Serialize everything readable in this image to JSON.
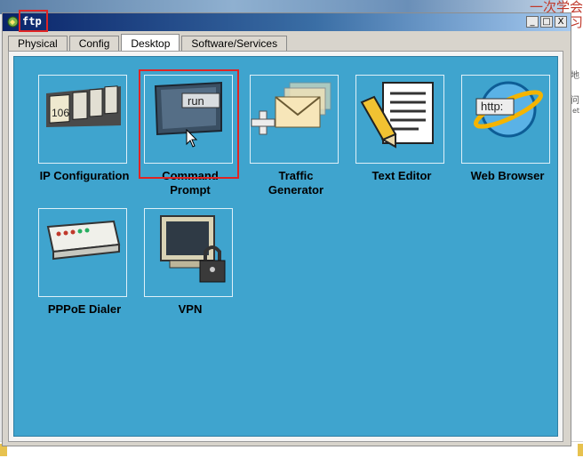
{
  "window": {
    "title": "ftp",
    "controls": {
      "minimize": "_",
      "maximize": "□",
      "close": "X"
    }
  },
  "tabs": [
    {
      "label": "Physical",
      "active": false
    },
    {
      "label": "Config",
      "active": false
    },
    {
      "label": "Desktop",
      "active": true
    },
    {
      "label": "Software/Services",
      "active": false
    }
  ],
  "apps": {
    "ip_config": {
      "label": "IP Configuration",
      "icon": "ip-configuration-icon",
      "icon_text": "106"
    },
    "command_prompt": {
      "label": "Command Prompt",
      "icon": "command-prompt-icon",
      "icon_text": "run",
      "highlighted": true
    },
    "traffic_generator": {
      "label": "Traffic Generator",
      "icon": "traffic-generator-icon"
    },
    "text_editor": {
      "label": "Text Editor",
      "icon": "text-editor-icon"
    },
    "web_browser": {
      "label": "Web Browser",
      "icon": "web-browser-icon",
      "icon_text": "http:"
    },
    "pppoe_dialer": {
      "label": "PPPoE Dialer",
      "icon": "pppoe-dialer-icon"
    },
    "vpn": {
      "label": "VPN",
      "icon": "vpn-icon"
    }
  },
  "background": {
    "chinese_top": "一次学会",
    "chinese_mid": "解百学习",
    "side_char_1": "地",
    "side_char_2": "问",
    "side_char_3": "et"
  },
  "colors": {
    "desktop_bg": "#3fa4ce",
    "highlight": "#e02424",
    "titlebar_start": "#0a246a",
    "titlebar_end": "#a6caf0"
  }
}
